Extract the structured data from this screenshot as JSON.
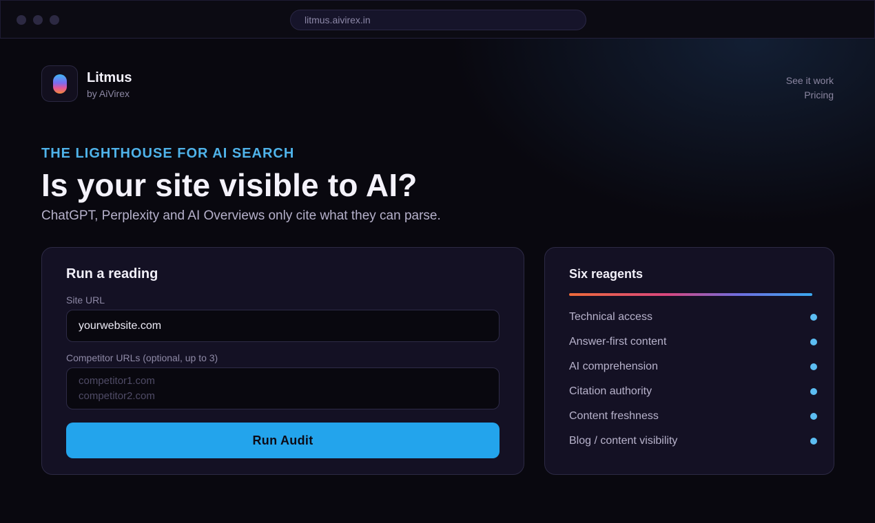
{
  "browser": {
    "url": "litmus.aivirex.in"
  },
  "brand": {
    "name": "Litmus",
    "tagline": "by AiVirex"
  },
  "nav": {
    "items": [
      "See it work",
      "Pricing"
    ]
  },
  "hero": {
    "eyebrow": "THE LIGHTHOUSE FOR AI SEARCH",
    "headline": "Is your site visible to AI?",
    "subhead": "ChatGPT, Perplexity and AI Overviews only cite what they can parse."
  },
  "audit_form": {
    "title": "Run a reading",
    "site_url_label": "Site URL",
    "site_url_value": "yourwebsite.com",
    "competitor_label": "Competitor URLs (optional, up to 3)",
    "competitor_placeholder": "competitor1.com\ncompetitor2.com",
    "submit_label": "Run Audit"
  },
  "reagents": {
    "title": "Six reagents",
    "items": [
      "Technical access",
      "Answer-first content",
      "AI comprehension",
      "Citation authority",
      "Content freshness",
      "Blog / content visibility"
    ]
  },
  "colors": {
    "accent": "#23a4ec",
    "eyebrow": "#4fb3ea",
    "bullet": "#5cbdf2",
    "background": "#09080f",
    "card": "#141124"
  }
}
